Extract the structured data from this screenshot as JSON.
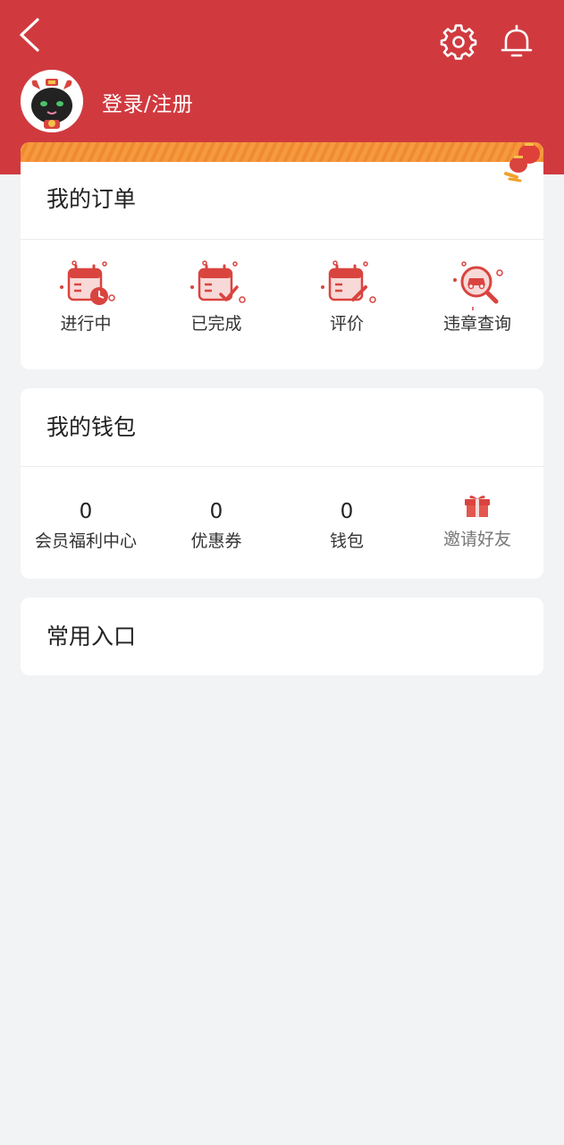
{
  "header": {
    "login_text": "登录/注册",
    "background_color": "#d03a3f",
    "icons": [
      "back-icon",
      "gear-icon",
      "bell-icon"
    ]
  },
  "orders": {
    "title": "我的订单",
    "items": [
      {
        "label": "进行中",
        "icon": "calendar-clock-icon"
      },
      {
        "label": "已完成",
        "icon": "calendar-check-icon"
      },
      {
        "label": "评价",
        "icon": "calendar-edit-icon"
      },
      {
        "label": "违章查询",
        "icon": "car-search-icon"
      }
    ]
  },
  "wallet": {
    "title": "我的钱包",
    "items": [
      {
        "count": "0",
        "label": "会员福利中心"
      },
      {
        "count": "0",
        "label": "优惠券"
      },
      {
        "count": "0",
        "label": "钱包"
      },
      {
        "label": "邀请好友",
        "icon": "gift-icon"
      }
    ]
  },
  "entries": {
    "title": "常用入口"
  },
  "colors": {
    "accent": "#d03a3f",
    "icon_red": "#d9443f",
    "page_bg": "#f2f3f5"
  }
}
